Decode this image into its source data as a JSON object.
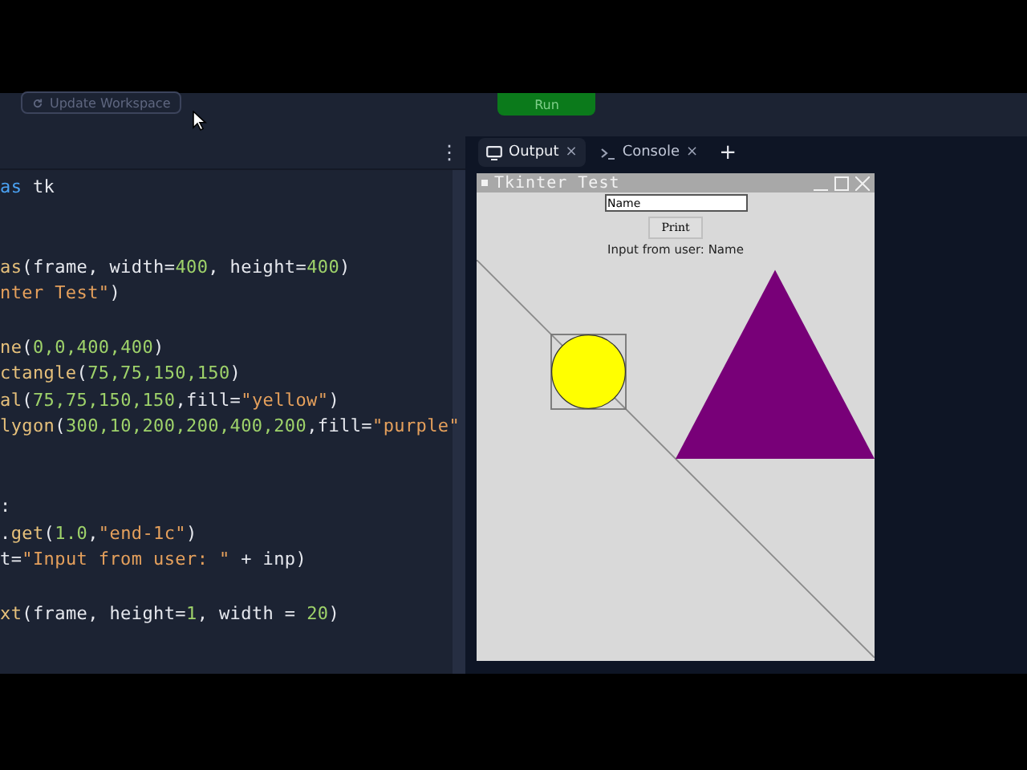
{
  "toolbar": {
    "update_button": "Update Workspace",
    "run_button": "Run"
  },
  "editor": {
    "menu": "⋮",
    "lines": [
      {
        "segments": [
          {
            "kind": "kw",
            "text": "as"
          },
          {
            "kind": "plain",
            "text": " tk"
          }
        ]
      },
      {
        "blank": true
      },
      {
        "blank": true
      },
      {
        "segments": [
          {
            "kind": "fn",
            "text": "as"
          },
          {
            "kind": "plain",
            "text": "(frame, width="
          },
          {
            "kind": "num",
            "text": "400"
          },
          {
            "kind": "plain",
            "text": ", height="
          },
          {
            "kind": "num",
            "text": "400"
          },
          {
            "kind": "plain",
            "text": ")"
          }
        ]
      },
      {
        "segments": [
          {
            "kind": "str",
            "text": "nter Test\""
          },
          {
            "kind": "plain",
            "text": ")"
          }
        ]
      },
      {
        "blank": true
      },
      {
        "segments": [
          {
            "kind": "fn",
            "text": "ne"
          },
          {
            "kind": "plain",
            "text": "("
          },
          {
            "kind": "num",
            "text": "0,0,400,400"
          },
          {
            "kind": "plain",
            "text": ")"
          }
        ]
      },
      {
        "segments": [
          {
            "kind": "fn",
            "text": "ctangle"
          },
          {
            "kind": "plain",
            "text": "("
          },
          {
            "kind": "num",
            "text": "75,75,150,150"
          },
          {
            "kind": "plain",
            "text": ")"
          }
        ]
      },
      {
        "segments": [
          {
            "kind": "fn",
            "text": "al"
          },
          {
            "kind": "plain",
            "text": "("
          },
          {
            "kind": "num",
            "text": "75,75,150,150"
          },
          {
            "kind": "plain",
            "text": ",fill="
          },
          {
            "kind": "str",
            "text": "\"yellow\""
          },
          {
            "kind": "plain",
            "text": ")"
          }
        ]
      },
      {
        "segments": [
          {
            "kind": "fn",
            "text": "lygon"
          },
          {
            "kind": "plain",
            "text": "("
          },
          {
            "kind": "num",
            "text": "300,10,200,200,400,200"
          },
          {
            "kind": "plain",
            "text": ",fill="
          },
          {
            "kind": "str",
            "text": "\"purple\""
          }
        ]
      },
      {
        "blank": true
      },
      {
        "blank": true
      },
      {
        "segments": [
          {
            "kind": "plain",
            "text": ":"
          }
        ]
      },
      {
        "segments": [
          {
            "kind": "plain",
            "text": "."
          },
          {
            "kind": "fn",
            "text": "get"
          },
          {
            "kind": "plain",
            "text": "("
          },
          {
            "kind": "num",
            "text": "1.0"
          },
          {
            "kind": "plain",
            "text": ","
          },
          {
            "kind": "str",
            "text": "\"end-1c\""
          },
          {
            "kind": "plain",
            "text": ")"
          }
        ]
      },
      {
        "segments": [
          {
            "kind": "plain",
            "text": "t="
          },
          {
            "kind": "str",
            "text": "\"Input from user: \""
          },
          {
            "kind": "plain",
            "text": " + inp)"
          }
        ]
      },
      {
        "blank": true
      },
      {
        "segments": [
          {
            "kind": "fn",
            "text": "xt"
          },
          {
            "kind": "plain",
            "text": "(frame, height="
          },
          {
            "kind": "num",
            "text": "1"
          },
          {
            "kind": "plain",
            "text": ", width = "
          },
          {
            "kind": "num",
            "text": "20"
          },
          {
            "kind": "plain",
            "text": ")"
          }
        ]
      }
    ]
  },
  "tabs": [
    {
      "label": "Output",
      "kind": "output",
      "selected": true,
      "close": "×"
    },
    {
      "label": "Console",
      "kind": "console",
      "selected": false,
      "close": "×"
    }
  ],
  "add_tab": "+",
  "app_window": {
    "title": "Tkinter Test",
    "entry_value": "Name",
    "button": "Print",
    "output_label": "Input from user: Name"
  }
}
